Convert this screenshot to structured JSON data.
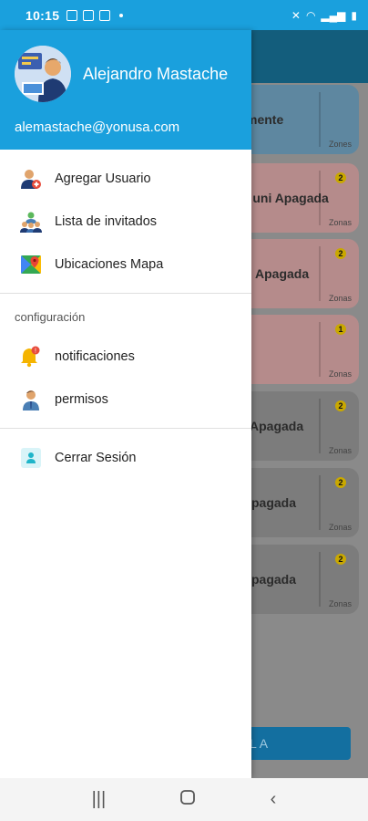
{
  "status_bar": {
    "time": "10:15"
  },
  "background": {
    "cards": [
      {
        "text": "mente",
        "bg": "#5e87a0",
        "zones": "Zones",
        "badge": ""
      },
      {
        "text": "r uni Apagada",
        "bg": "#b58b8b",
        "zones": "Zonas",
        "badge": "2"
      },
      {
        "text": "Apagada",
        "bg": "#b58b8b",
        "zones": "Zonas",
        "badge": "2"
      },
      {
        "text": "",
        "bg": "#b58b8b",
        "zones": "Zonas",
        "badge": "1"
      },
      {
        "text": "Apagada",
        "bg": "#7c7c7c",
        "zones": "Zonas",
        "badge": "2"
      },
      {
        "text": "pagada",
        "bg": "#7c7c7c",
        "zones": "Zonas",
        "badge": "2"
      },
      {
        "text": "pagada",
        "bg": "#7c7c7c",
        "zones": "Zonas",
        "badge": "2"
      }
    ],
    "button_label": "LA"
  },
  "drawer": {
    "user_name": "Alejandro Mastache",
    "user_email": "alemastache@yonusa.com",
    "items_top": [
      {
        "label": "Agregar Usuario",
        "icon": "add-user-icon"
      },
      {
        "label": "Lista de invitados",
        "icon": "guests-icon"
      },
      {
        "label": "Ubicaciones Mapa",
        "icon": "map-icon"
      }
    ],
    "section_title": "configuración",
    "items_config": [
      {
        "label": "notificaciones",
        "icon": "bell-icon"
      },
      {
        "label": "permisos",
        "icon": "user-permission-icon"
      }
    ],
    "logout_label": "Cerrar Sesión"
  },
  "colors": {
    "accent": "#1aa0dd"
  }
}
